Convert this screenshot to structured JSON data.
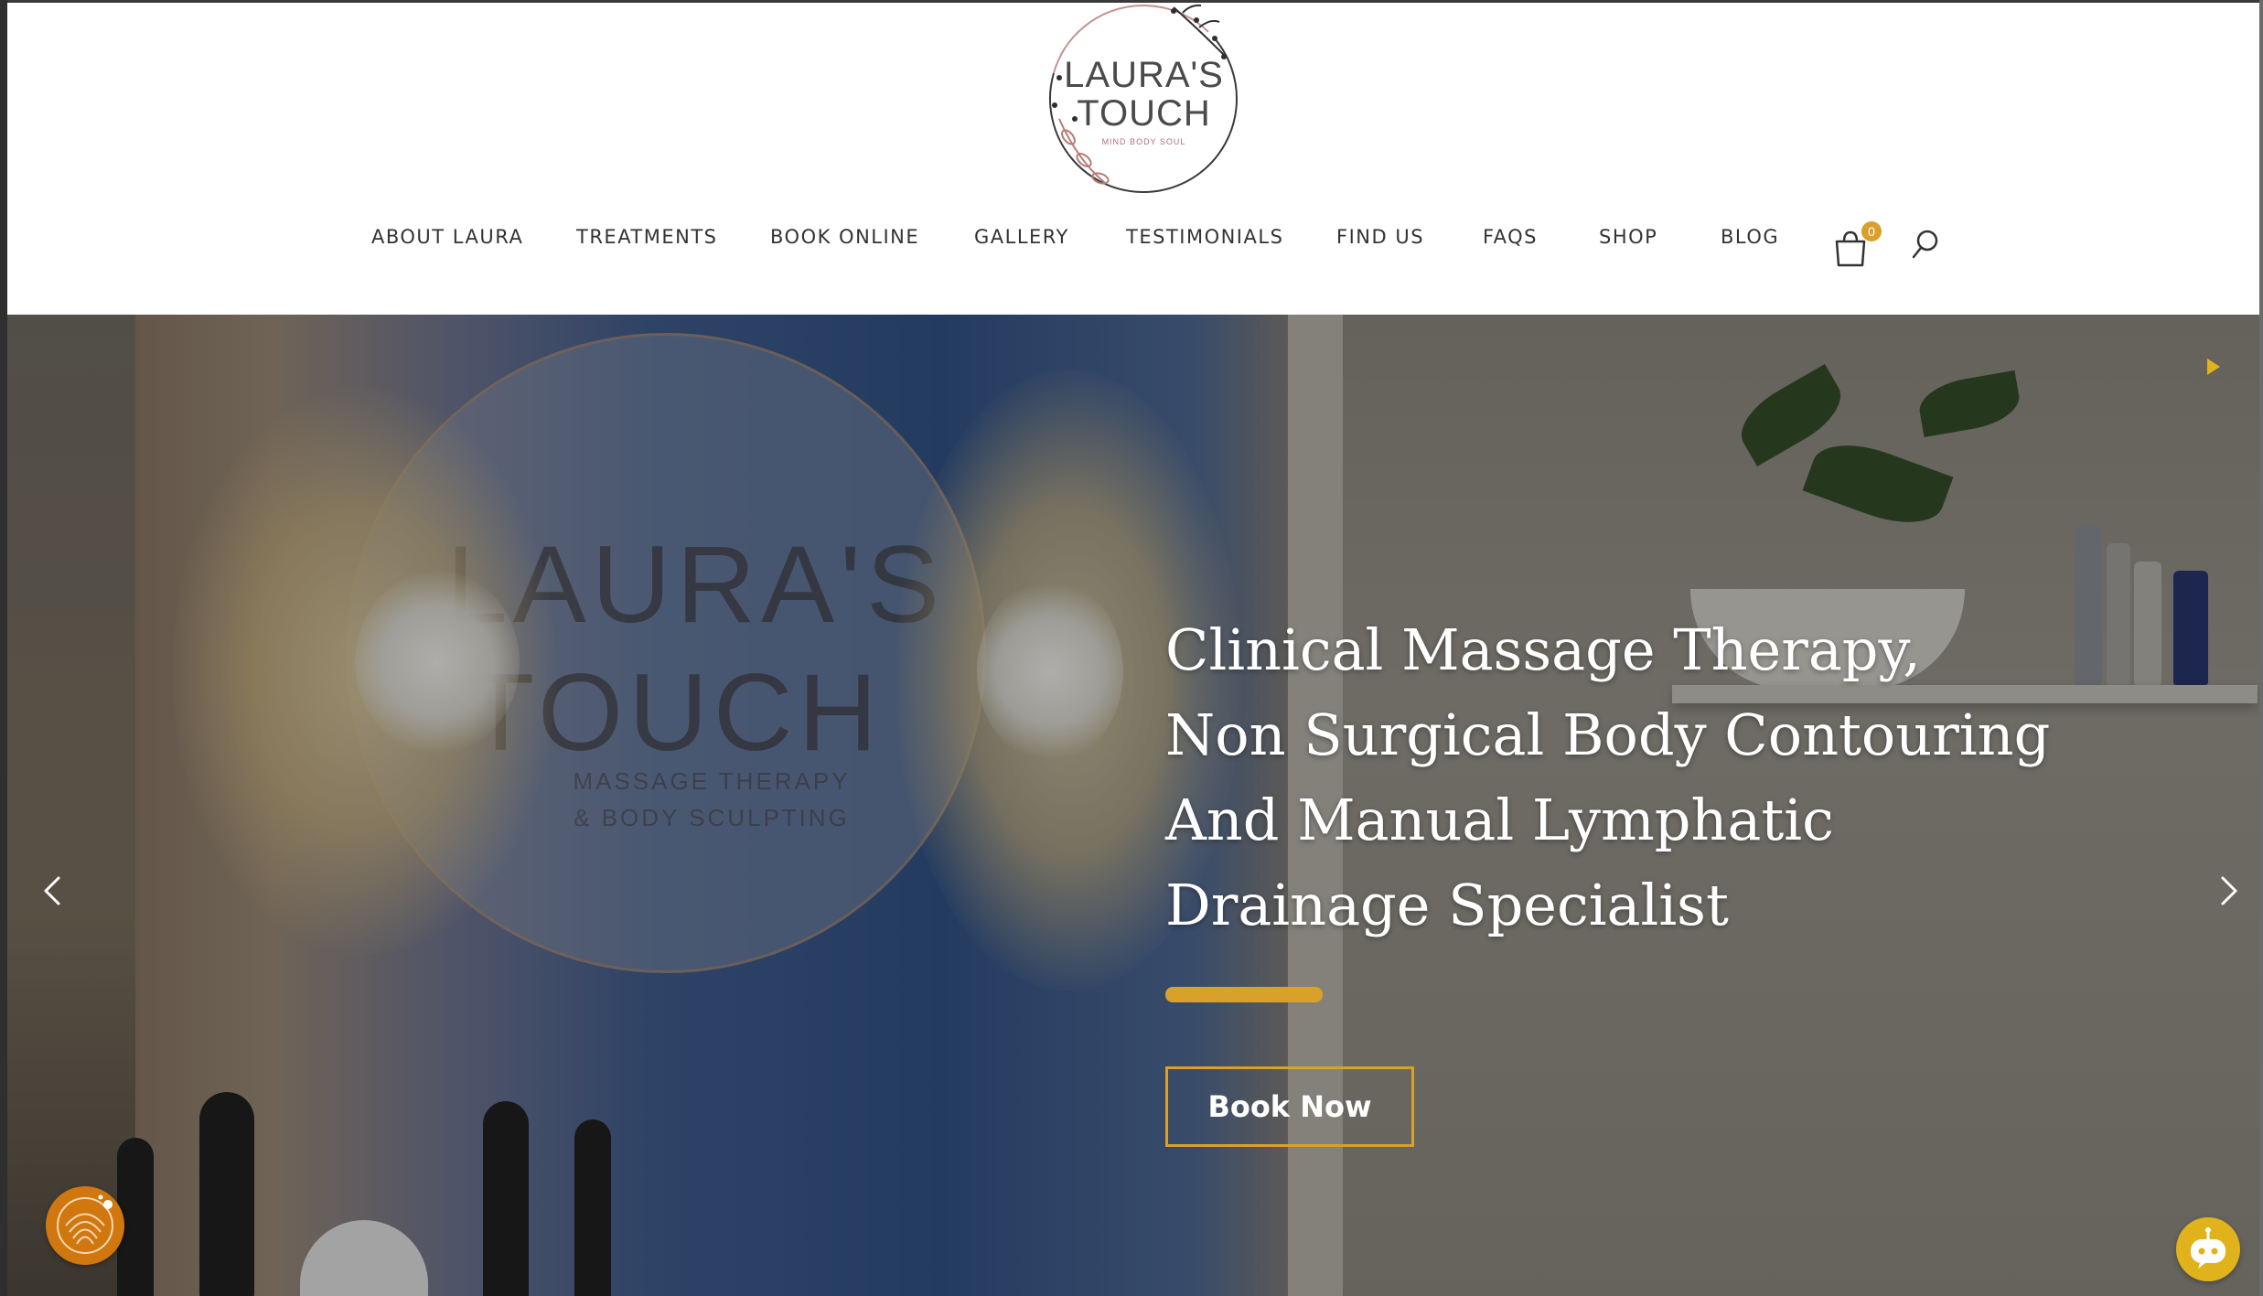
{
  "logo": {
    "line1": "LAURA'S",
    "line2": "TOUCH",
    "tagline": "MIND BODY SOUL"
  },
  "nav": {
    "items": [
      {
        "label": "ABOUT LAURA"
      },
      {
        "label": "TREATMENTS"
      },
      {
        "label": "BOOK ONLINE"
      },
      {
        "label": "GALLERY"
      },
      {
        "label": "TESTIMONIALS"
      },
      {
        "label": "FIND US"
      },
      {
        "label": "FAQS"
      },
      {
        "label": "SHOP"
      },
      {
        "label": "BLOG"
      }
    ],
    "cart_count": "0",
    "cart_icon": "shopping-bag-icon",
    "search_icon": "search-icon"
  },
  "hero": {
    "heading_lines": [
      "Clinical Massage Therapy,",
      "Non Surgical Body Contouring",
      "And Manual Lymphatic",
      "Drainage Specialist"
    ],
    "background_sign_line1": "LAURA'S",
    "background_sign_line2": "TOUCH",
    "background_sign_sub1": "MASSAGE THERAPY",
    "background_sign_sub2": "& BODY SCULPTING",
    "cta_label": "Book Now",
    "prev_icon": "chevron-left-icon",
    "next_icon": "chevron-right-icon",
    "play_icon": "play-icon"
  },
  "widgets": {
    "accessibility_icon": "accessibility-icon",
    "chat_icon": "chatbot-icon"
  },
  "colors": {
    "accent": "#d9a02a",
    "nav_text": "#333333",
    "accessibility_bg": "#d0780f",
    "chat_bg": "#e0b21c"
  }
}
